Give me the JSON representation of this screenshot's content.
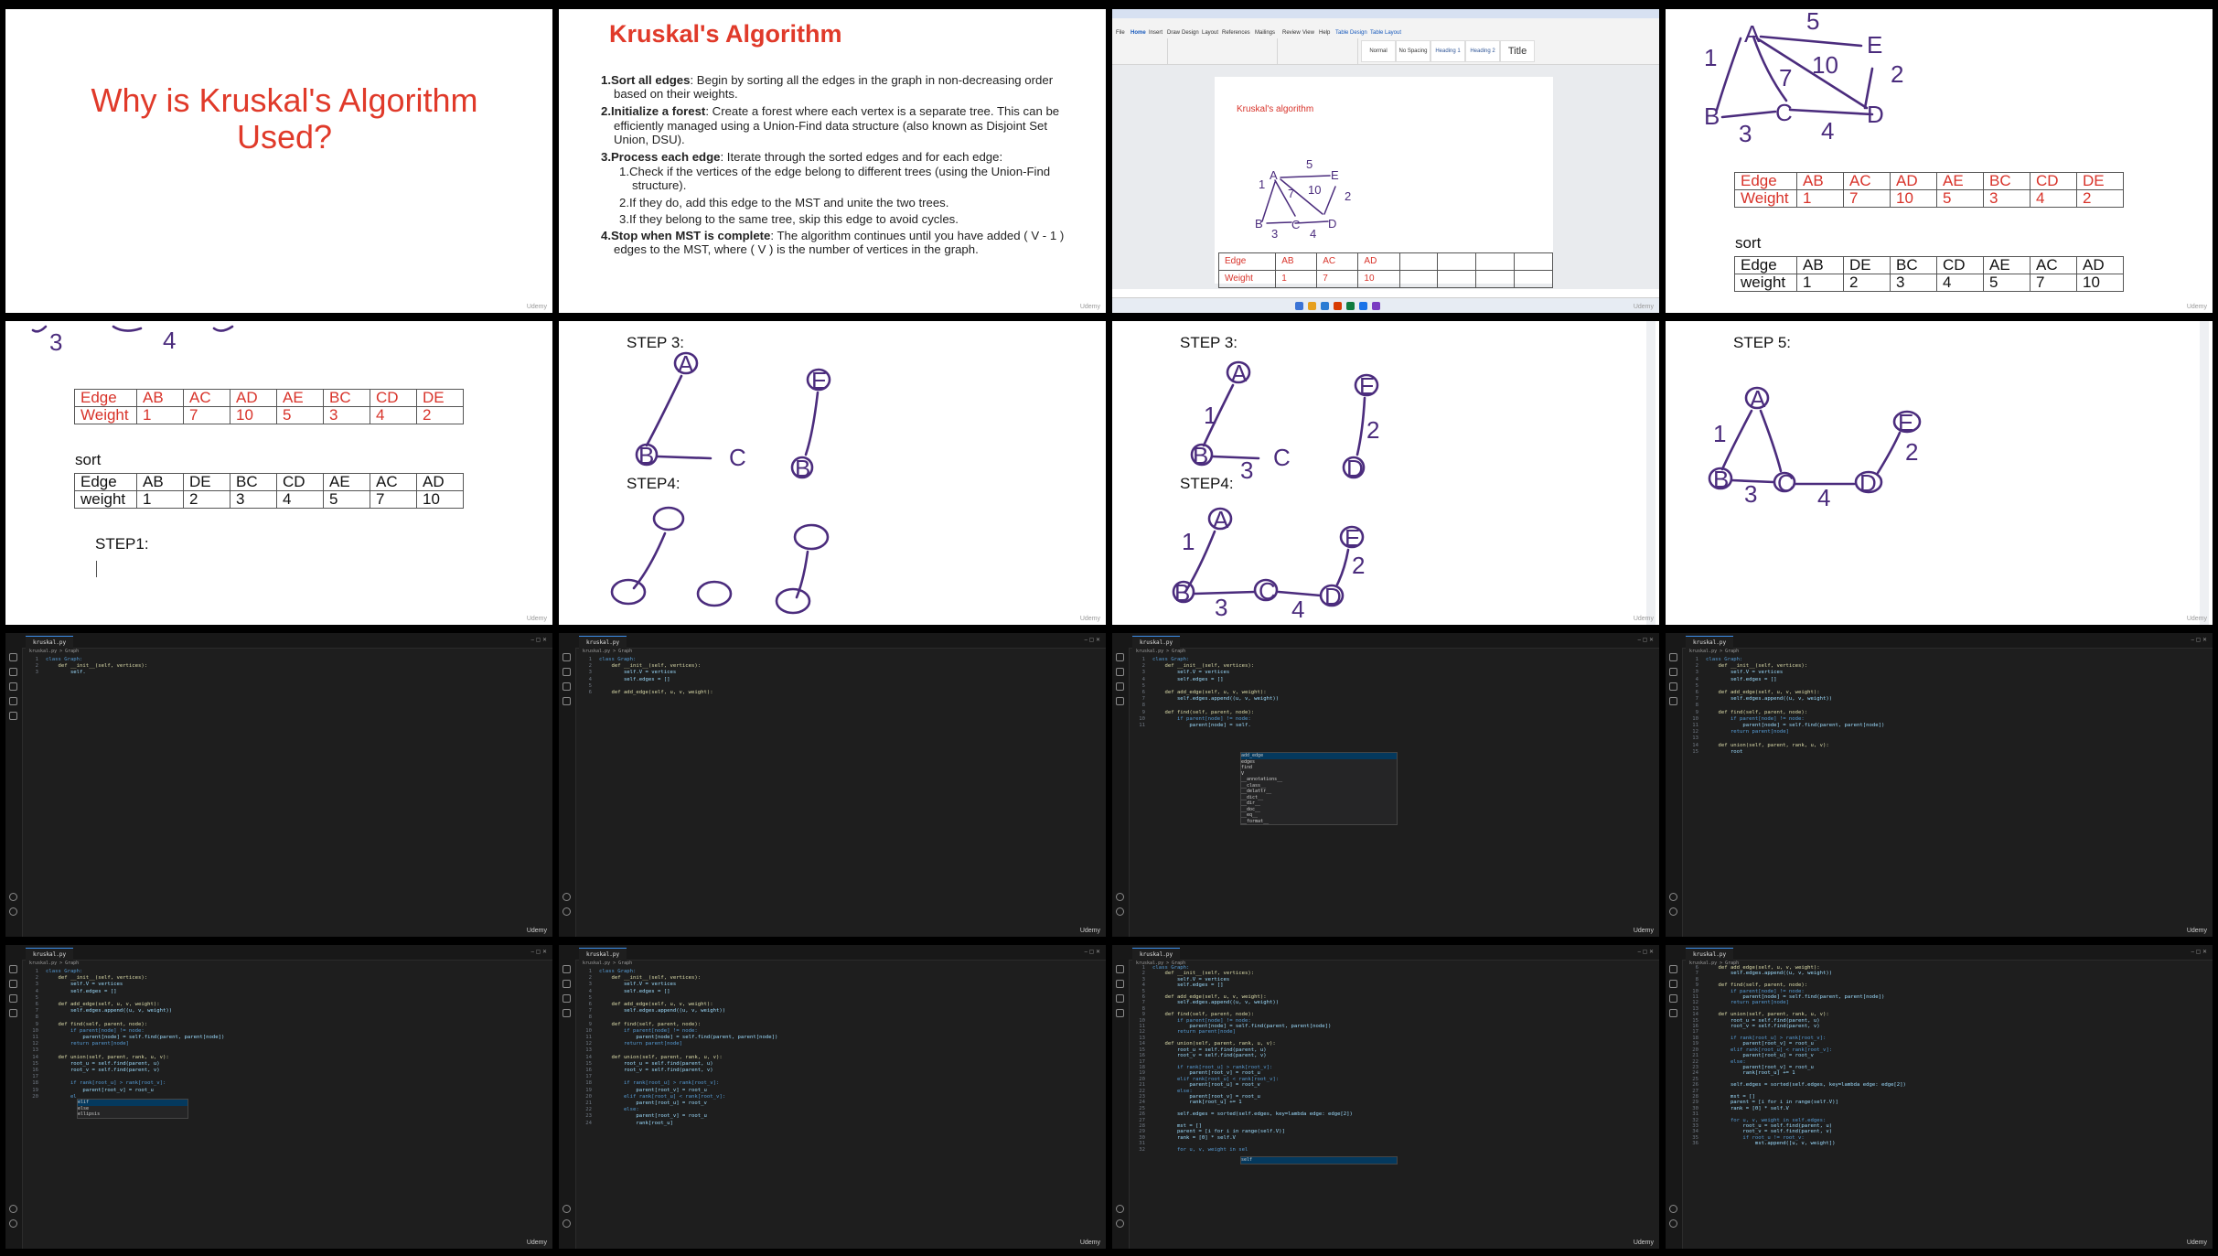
{
  "watermark": "Udemy",
  "slide1": {
    "title": "Why is Kruskal's Algorithm Used?"
  },
  "slide2": {
    "title": "Kruskal's Algorithm",
    "step1_head": "1.Sort all edges",
    "step1_body": ": Begin by sorting all the edges in the graph in non-decreasing order based on their weights.",
    "step2_head": "2.Initialize a forest",
    "step2_body": ": Create a forest where each vertex is a separate tree. This can be efficiently managed using a Union-Find data structure (also known as Disjoint Set Union, DSU).",
    "step3_head": "3.Process each edge",
    "step3_body": ": Iterate through the sorted edges and for each edge:",
    "sub1": "1.Check if the vertices of the edge belong to different trees (using the Union-Find structure).",
    "sub2": "2.If they do, add this edge to the MST and unite the two trees.",
    "sub3": "3.If they belong to the same tree, skip this edge to avoid cycles.",
    "step4_head": "4.Stop when MST is complete",
    "step4_body": ": The algorithm continues until you have added ( V - 1 ) edges to the MST, where ( V ) is the number of vertices in the graph."
  },
  "word": {
    "doc_title": "Kruskal's algorithm",
    "tabs": [
      "File",
      "Home",
      "Insert",
      "Draw",
      "Design",
      "Layout",
      "References",
      "Mailings",
      "Review",
      "View",
      "Help",
      "Table Design",
      "Table Layout"
    ],
    "styles": [
      "Normal",
      "No Spacing",
      "Heading 1",
      "Heading 2",
      "Title"
    ],
    "table_header": [
      "Edge",
      "AB",
      "AC",
      "AD"
    ],
    "table_row": [
      "Weight",
      "1",
      "7",
      "10"
    ]
  },
  "edges_table": {
    "header": [
      "Edge",
      "AB",
      "AC",
      "AD",
      "AE",
      "BC",
      "CD",
      "DE"
    ],
    "row": [
      "Weight",
      "1",
      "7",
      "10",
      "5",
      "3",
      "4",
      "2"
    ]
  },
  "sorted_table": {
    "label": "sort",
    "header": [
      "Edge",
      "AB",
      "DE",
      "BC",
      "CD",
      "AE",
      "AC",
      "AD"
    ],
    "row": [
      "weight",
      "1",
      "2",
      "3",
      "4",
      "5",
      "7",
      "10"
    ]
  },
  "steps": {
    "step1": "STEP1:",
    "step3": "STEP 3:",
    "step4": "STEP4:",
    "step5": "STEP 5:"
  },
  "graph_labels": {
    "A": "A",
    "B": "B",
    "C": "C",
    "D": "D",
    "E": "E",
    "w1": "1",
    "w2": "2",
    "w3": "3",
    "w4": "4",
    "w5": "5",
    "w7": "7",
    "w10": "10"
  },
  "ide": {
    "file_tab": "kruskal.py",
    "breadcrumb": "kruskal.py > Graph",
    "autocomplete1": [
      "add_edge",
      "edges",
      "find",
      "V",
      "__annotations__",
      "__class__",
      "__delattr__",
      "__dict__",
      "__dir__",
      "__doc__",
      "__eq__",
      "__format__"
    ],
    "autocomplete2": [
      "parent",
      "rank",
      "self"
    ]
  },
  "code": {
    "l1": "class Graph:",
    "l2": "    def __init__(self, vertices):",
    "l3": "        self.V = vertices",
    "l4": "        self.edges = []",
    "l6": "    def add_edge(self, u, v, weight):",
    "l7": "        self.edges.append((u, v, weight))",
    "l9": "    def find(self, parent, node):",
    "l10": "        if parent[node] != node:",
    "l11": "            parent[node] = self.find(parent, parent[node])",
    "l12": "        return parent[node]",
    "l14": "    def union(self, parent, rank, u, v):",
    "l15": "        root_u = self.find(parent, u)",
    "l16": "        root_v = self.find(parent, v)",
    "l18": "        if rank[root_u] > rank[root_v]:",
    "l19": "            parent[root_v] = root_u",
    "l20": "        elif rank[root_u] < rank[root_v]:",
    "l21": "            parent[root_u] = root_v",
    "l22": "        else:",
    "l23": "            parent[root_v] = root_u",
    "l24": "            rank[root_u] += 1",
    "l26": "        self.edges = sorted(self.edges, key=lambda edge: edge[2])",
    "l28": "        mst = []",
    "l29": "        parent = [i for i in range(self.V)]",
    "l30": "        rank = [0] * self.V",
    "l32": "        for u, v, weight in self.edges:",
    "l33": "            root_u = self.find(parent, u)",
    "l34": "            root_v = self.find(parent, v)",
    "l35": "            if root_u != root_v:",
    "l36": "                mst.append([u, v, weight])"
  },
  "colors": {
    "accent_red": "#e03a2a",
    "ink": "#4b2c7d",
    "ide_bg": "#1e1e1e"
  }
}
